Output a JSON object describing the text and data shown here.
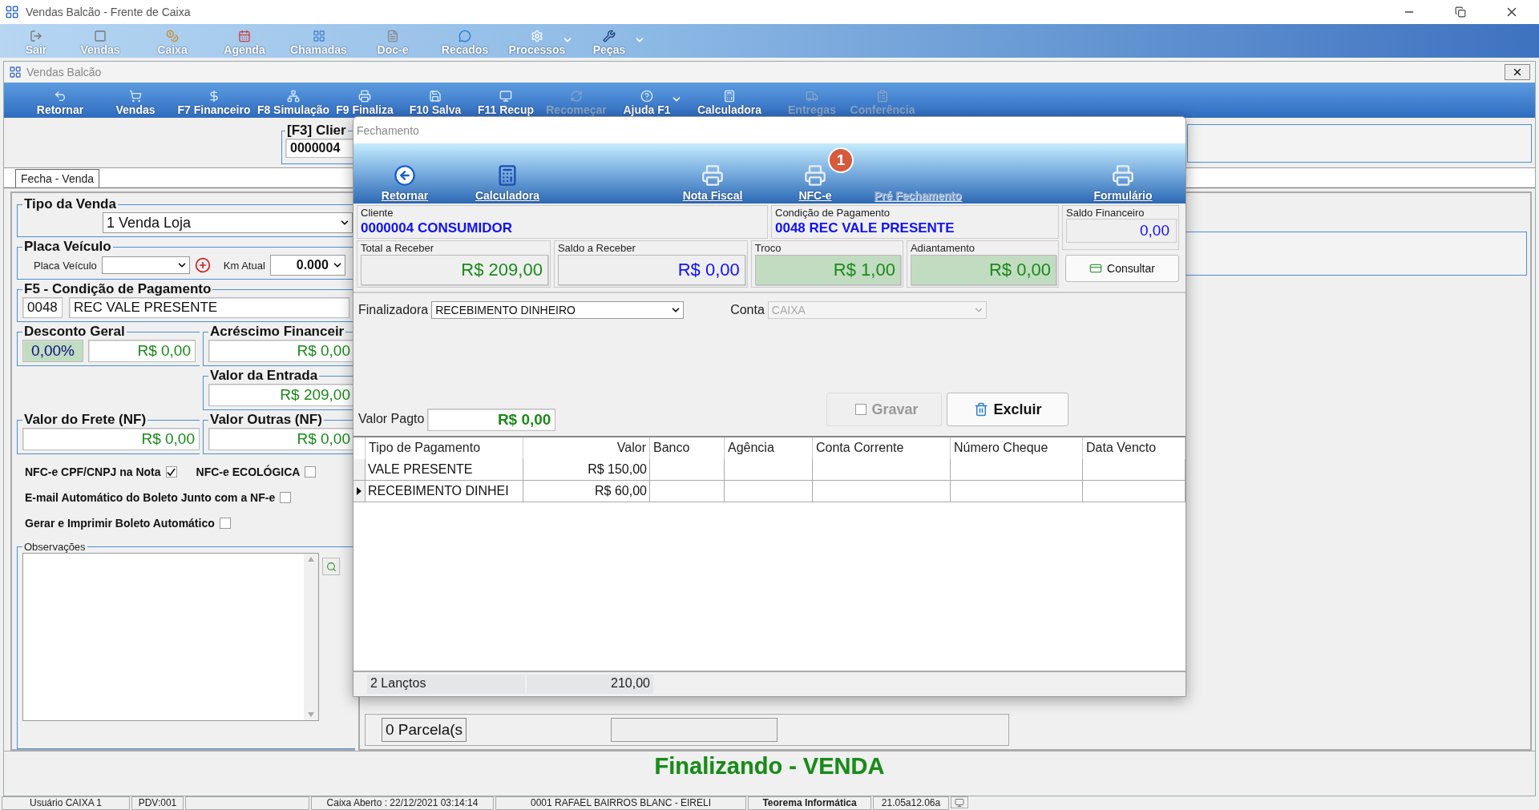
{
  "app": {
    "title": "Vendas Balcão - Frente de Caixa"
  },
  "main_toolbar": [
    {
      "label": "Sair",
      "dropdown": false
    },
    {
      "label": "Vendas",
      "dropdown": false
    },
    {
      "label": "Caixa",
      "dropdown": false
    },
    {
      "label": "Agenda",
      "dropdown": false
    },
    {
      "label": "Chamadas",
      "dropdown": false
    },
    {
      "label": "Doc-e",
      "dropdown": false
    },
    {
      "label": "Recados",
      "dropdown": false
    },
    {
      "label": "Processos",
      "dropdown": true
    },
    {
      "label": "Peças",
      "dropdown": true
    }
  ],
  "inner_window": {
    "title": "Vendas Balcão"
  },
  "sale_toolbar": [
    {
      "label": "Retornar",
      "disabled": false,
      "dropdown": false
    },
    {
      "label": "Vendas",
      "disabled": false,
      "dropdown": false
    },
    {
      "label": "F7 Financeiro",
      "disabled": false,
      "dropdown": false
    },
    {
      "label": "F8 Simulação",
      "disabled": false,
      "dropdown": false
    },
    {
      "label": "F9 Finaliza",
      "disabled": false,
      "dropdown": false
    },
    {
      "label": "F10 Salva",
      "disabled": false,
      "dropdown": false
    },
    {
      "label": "F11 Recup",
      "disabled": false,
      "dropdown": false
    },
    {
      "label": "Recomeçar",
      "disabled": true,
      "dropdown": false
    },
    {
      "label": "Ajuda F1",
      "disabled": false,
      "dropdown": true
    },
    {
      "label": "Calculadora",
      "disabled": false,
      "dropdown": false
    },
    {
      "label": "Entregas",
      "disabled": true,
      "dropdown": false
    },
    {
      "label": "Conferência",
      "disabled": true,
      "dropdown": false
    }
  ],
  "client_lookup": {
    "label": "[F3] Clier",
    "value": "0000004"
  },
  "tabs": [
    {
      "label": "Fecha - Venda",
      "selected": true
    }
  ],
  "sale_form": {
    "tipo_venda": {
      "label": "Tipo da Venda",
      "value": "1 Venda Loja"
    },
    "placa": {
      "label": "Placa Veículo",
      "field_label": "Placa Veículo",
      "km_label": "Km Atual",
      "km_value": "0.000"
    },
    "condicao": {
      "label": "F5 - Condição de Pagamento",
      "code": "0048",
      "name": "REC VALE PRESENTE"
    },
    "desconto": {
      "label": "Desconto Geral",
      "percent": "0,00%",
      "value": "R$ 0,00"
    },
    "acrescimo": {
      "label": "Acréscimo Financeir",
      "value": "R$ 0,00"
    },
    "entrada": {
      "label": "Valor da Entrada",
      "value": "R$ 209,00"
    },
    "frete": {
      "label": "Valor do Frete (NF)",
      "value": "R$ 0,00"
    },
    "outras": {
      "label": "Valor Outras (NF)",
      "value": "R$ 0,00"
    },
    "option_rows": [
      [
        {
          "label": "NFC-e CPF/CNPJ na Nota",
          "checked": true
        },
        {
          "label": "NFC-e ECOLÓGICA",
          "checked": false
        }
      ],
      [
        {
          "label": "E-mail Automático do Boleto Junto com a NF-e",
          "checked": false
        }
      ],
      [
        {
          "label": "Gerar e Imprimir Boleto Automático",
          "checked": false
        }
      ]
    ],
    "observacoes": {
      "label": "Observações"
    }
  },
  "parcelas": {
    "label": "0 Parcela(s"
  },
  "banner": "Finalizando - VENDA",
  "status_bar": [
    {
      "text": "Usuário CAIXA 1",
      "emphasis": false
    },
    {
      "text": "PDV:001",
      "emphasis": false
    },
    {
      "text": "Caixa Aberto : 22/12/2021 03:14:14",
      "emphasis": false
    },
    {
      "text": "0001 RAFAEL BAIRROS BLANC - EIRELI",
      "emphasis": false
    },
    {
      "text": "Teorema Informática",
      "emphasis": true
    },
    {
      "text": "21.05a12.06a",
      "emphasis": false
    }
  ],
  "dialog": {
    "title": "Fechamento",
    "toolbar": [
      {
        "label": "Retornar",
        "disabled": false
      },
      {
        "label": "Calculadora",
        "disabled": false
      },
      {
        "label": "Nota Fiscal",
        "disabled": false
      },
      {
        "label": "NFC-e",
        "disabled": false,
        "badge": "1"
      },
      {
        "label": "Pré Fechamento",
        "disabled": true
      },
      {
        "label": "Formulário",
        "disabled": false
      }
    ],
    "cliente": {
      "label": "Cliente",
      "value": "0000004 CONSUMIDOR"
    },
    "condicao": {
      "label": "Condição de Pagamento",
      "value": "0048 REC VALE PRESENTE"
    },
    "saldo_financeiro": {
      "label": "Saldo Financeiro",
      "value": "0,00"
    },
    "amounts": [
      {
        "label": "Total a Receber",
        "value": "R$ 209,00",
        "color": "#1a8a1a",
        "highlighted": false
      },
      {
        "label": "Saldo a Receber",
        "value": "R$ 0,00",
        "color": "#1010ff",
        "highlighted": false
      },
      {
        "label": "Troco",
        "value": "R$ 1,00",
        "color": "#1a8a1a",
        "highlighted": true
      },
      {
        "label": "Adiantamento",
        "value": "R$ 0,00",
        "color": "#1a8a1a",
        "highlighted": true
      }
    ],
    "consultar": {
      "label": "Consultar"
    },
    "finalizadora": {
      "label": "Finalizadora",
      "value": "RECEBIMENTO DINHEIRO"
    },
    "conta": {
      "label": "Conta",
      "value": "CAIXA",
      "disabled": true
    },
    "valor_pagto": {
      "label": "Valor Pagto",
      "value": "R$ 0,00"
    },
    "buttons": [
      {
        "label": "Gravar",
        "disabled": true
      },
      {
        "label": "Excluir",
        "disabled": false
      }
    ],
    "table": {
      "columns": [
        "Tipo de Pagamento",
        "Valor",
        "Banco",
        "Agência",
        "Conta Corrente",
        "Número Cheque",
        "Data Vencto"
      ],
      "rows": [
        {
          "cells": [
            "VALE PRESENTE",
            "R$ 150,00"
          ],
          "selected": false
        },
        {
          "cells": [
            "RECEBIMENTO DINHEI",
            "R$ 60,00"
          ],
          "selected": true
        }
      ],
      "footer": [
        "2 Lançtos",
        "210,00"
      ]
    }
  }
}
